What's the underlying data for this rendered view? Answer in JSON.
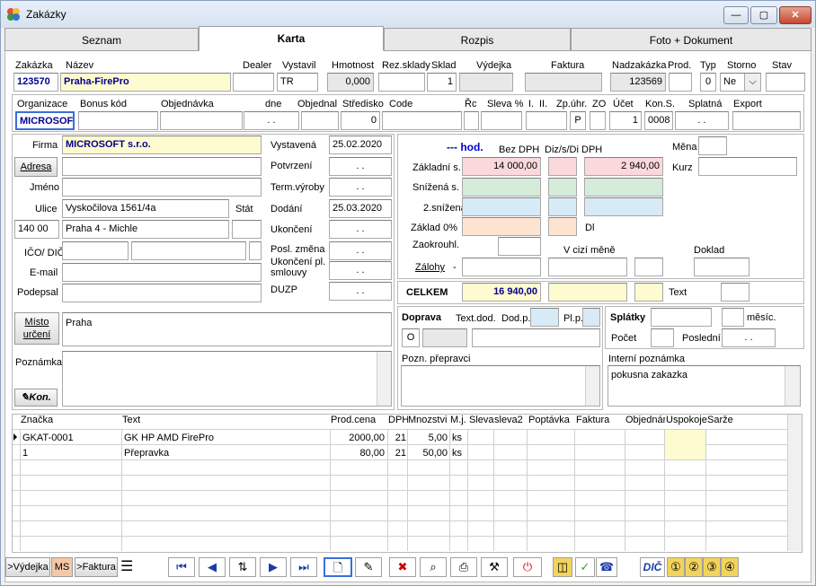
{
  "window": {
    "title": "Zakázky",
    "min": "—",
    "max": "▢",
    "close": "✕"
  },
  "tabs": [
    "Seznam",
    "Karta",
    "Rozpis",
    "Foto + Dokument"
  ],
  "header": {
    "labels": {
      "zakazka": "Zakázka",
      "nazev": "Název",
      "dealer": "Dealer",
      "vystavil": "Vystavil",
      "hmotnost": "Hmotnost",
      "rezsklady": "Rez.sklady",
      "sklad": "Sklad",
      "vydejka": "Výdejka",
      "faktura": "Faktura",
      "nadzakazka": "Nadzakázka",
      "prod": "Prod.",
      "typ": "Typ",
      "storno": "Storno",
      "stav": "Stav"
    },
    "values": {
      "zakazka": "123570",
      "nazev": "Praha-FirePro",
      "vystavil": "TR",
      "hmotnost": "0,000",
      "sklad": "1",
      "nadzakazka": "123569",
      "typ": "0",
      "storno": "Ne"
    }
  },
  "org": {
    "labels": {
      "organizace": "Organizace",
      "bonus": "Bonus kód",
      "objednavka": "Objednávka",
      "dne": "dne",
      "objednal": "Objednal",
      "stredisko": "Středisko",
      "code": "Code",
      "rc": "Řc",
      "sleva": "Sleva %",
      "i": "I.",
      "ii": "II.",
      "zpuhr": "Zp.úhr.",
      "zo": "ZO",
      "ucet": "Účet",
      "kons": "Kon.S.",
      "splatna": "Splatná",
      "export": "Export"
    },
    "values": {
      "organizace": "MICROSOF",
      "dne": ". .",
      "stredisko": "0",
      "zpuhr": "P",
      "ucet": "1",
      "kons": "0008",
      "splatna": ". ."
    }
  },
  "firma": {
    "labels": {
      "firma": "Firma",
      "adresa": "Adresa",
      "jmeno": "Jméno",
      "ulice": "Ulice",
      "stat": "Stát",
      "ico": "IČO/ DIČ",
      "email": "E-mail",
      "podepsal": "Podepsal",
      "misto": "Místo určení",
      "poznamka": "Poznámka",
      "kon": "Kon."
    },
    "values": {
      "firma": "MICROSOFT s.r.o.",
      "ulice": "Vyskočilova 1561/4a",
      "psc": "140 00",
      "mesto": "Praha 4 - Michle",
      "misto": "Praha"
    }
  },
  "dates": {
    "labels": {
      "vystavena": "Vystavená",
      "potvrzeni": "Potvrzení",
      "termvyroby": "Term.výroby",
      "dodani": "Dodání",
      "ukonceni": "Ukončení",
      "poslzmena": "Posl. změna",
      "ukoncenipl": "Ukončení pl. smlouvy",
      "duzp": "DUZP"
    },
    "values": {
      "vystavena": "25.02.2020",
      "potvrzeni": ". .",
      "termvyroby": ". .",
      "dodani": "25.03.2020",
      "ukonceni": ". .",
      "poslzmena": ". .",
      "ukoncenipl": ". .",
      "duzp": ". ."
    }
  },
  "price": {
    "labels": {
      "hod": "--- hod.",
      "bezdph": "Bez DPH",
      "dizsdi": "Diz/s/Di",
      "dph": "DPH",
      "mena": "Měna",
      "kurz": "Kurz",
      "zakladni": "Základní s.",
      "snizena": "Snížená s.",
      "snizena2": "2.snížená",
      "zaklad0": "Základ 0%",
      "dl": "Dl",
      "zaokrouhl": "Zaokrouhl.",
      "vcizimene": "V cizí měně",
      "doklad": "Doklad",
      "zalohy": "Zálohy",
      "minus": "-",
      "celkem": "CELKEM",
      "text": "Text"
    },
    "values": {
      "zakladni_bez": "14 000,00",
      "zakladni_dph": "2 940,00",
      "celkem": "16 940,00"
    }
  },
  "doprava": {
    "labels": {
      "doprava": "Doprava",
      "textdod": "Text.dod.",
      "dodp": "Dod.p.",
      "plp": "Pl.p.",
      "splatky": "Splátky",
      "mesic": "měsíc.",
      "pocet": "Počet",
      "posledni": "Poslední",
      "poznprepravci": "Pozn. přepravci",
      "interni": "Interní poznámka"
    },
    "values": {
      "doprava": "O",
      "posledni": ". .",
      "interni": "pokusna zakazka"
    }
  },
  "grid": {
    "columns": [
      "Značka",
      "Text",
      "Prod.cena",
      "DPH",
      "Mnozstvi",
      "M.j.",
      "Sleva",
      "sleva2",
      "Poptávka",
      "Faktura",
      "Objednár",
      "Uspokoje",
      "Sarže"
    ],
    "rows": [
      [
        "GKAT-0001",
        "GK HP AMD FirePro",
        "2000,00",
        "21",
        "5,00",
        "ks"
      ],
      [
        "1",
        "Přepravka",
        "80,00",
        "21",
        "50,00",
        "ks"
      ]
    ]
  },
  "toolbar": {
    "vydejka": ">Výdejka",
    "ms": "MS",
    "faktura": ">Faktura",
    "dic": "DIČ"
  }
}
